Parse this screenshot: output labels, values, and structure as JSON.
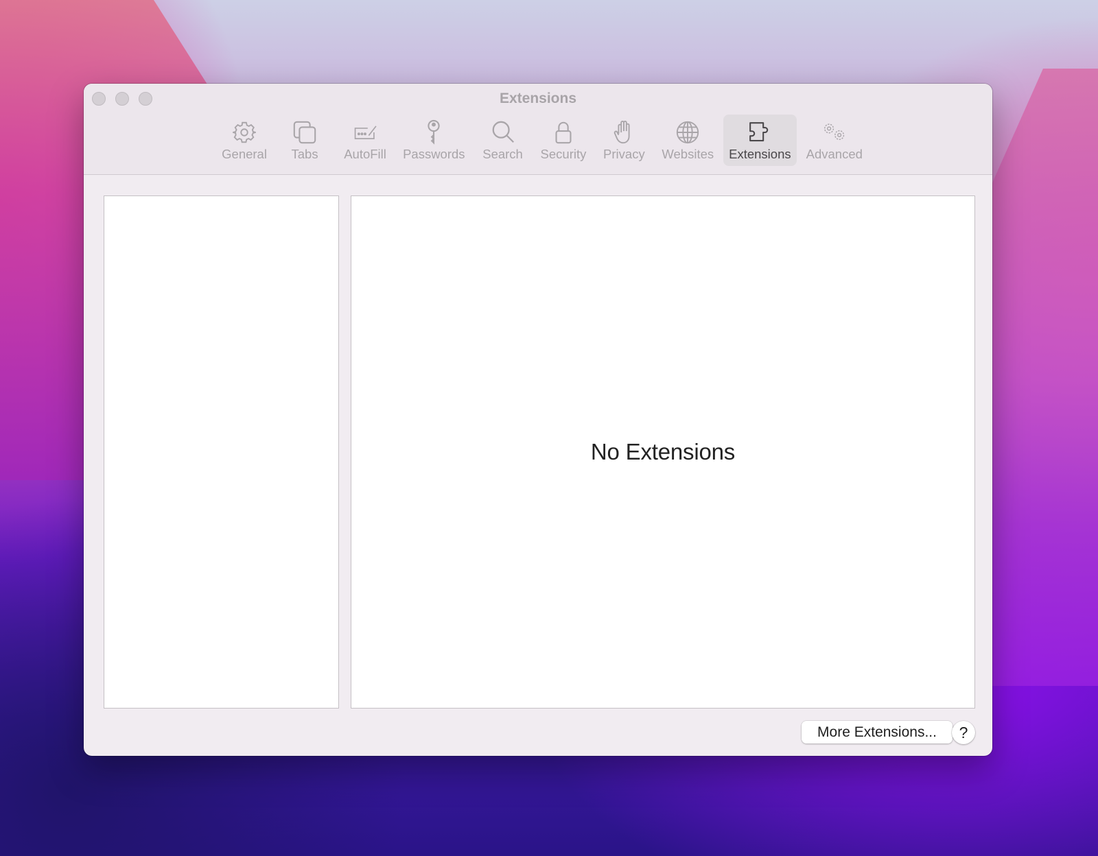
{
  "window": {
    "title": "Extensions"
  },
  "toolbar": {
    "items": [
      {
        "label": "General",
        "icon": "gear-icon",
        "active": false
      },
      {
        "label": "Tabs",
        "icon": "tabs-icon",
        "active": false
      },
      {
        "label": "AutoFill",
        "icon": "autofill-icon",
        "active": false
      },
      {
        "label": "Passwords",
        "icon": "key-icon",
        "active": false
      },
      {
        "label": "Search",
        "icon": "search-icon",
        "active": false
      },
      {
        "label": "Security",
        "icon": "lock-icon",
        "active": false
      },
      {
        "label": "Privacy",
        "icon": "hand-icon",
        "active": false
      },
      {
        "label": "Websites",
        "icon": "globe-icon",
        "active": false
      },
      {
        "label": "Extensions",
        "icon": "puzzle-icon",
        "active": true
      },
      {
        "label": "Advanced",
        "icon": "gears-icon",
        "active": false
      }
    ]
  },
  "main": {
    "empty_message": "No Extensions"
  },
  "footer": {
    "more_extensions_label": "More Extensions...",
    "help_label": "?"
  },
  "colors": {
    "window_bg": "#f1ecf1",
    "toolbar_text": "#a9a5a9",
    "toolbar_active_text": "#4a474a",
    "toolbar_active_bg": "#e0dce0"
  }
}
